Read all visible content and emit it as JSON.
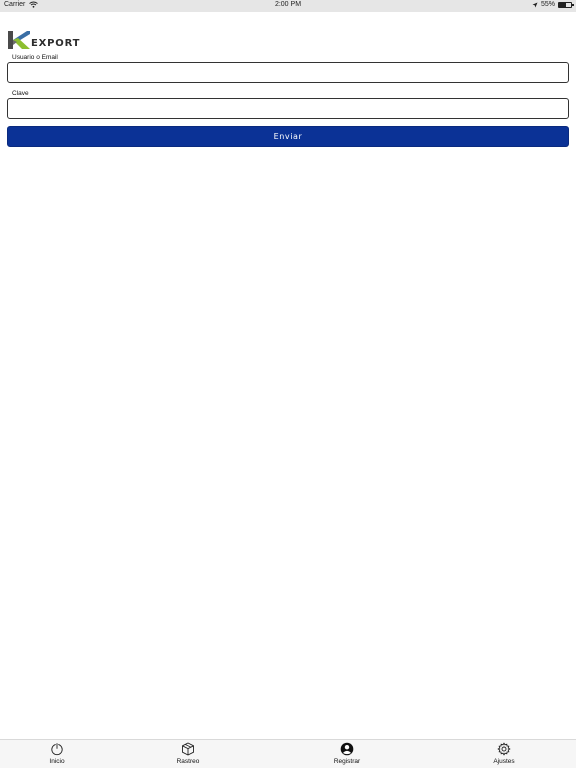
{
  "status_bar": {
    "carrier": "Carrier",
    "time": "2:00 PM",
    "battery": "55%",
    "battery_level": 0.55
  },
  "logo": {
    "text": "EXPORT",
    "icon": "k-logo-icon"
  },
  "form": {
    "username": {
      "label": "Usuario o Email",
      "value": "",
      "placeholder": ""
    },
    "password": {
      "label": "Clave",
      "value": "",
      "placeholder": ""
    },
    "submit_label": "Enviar"
  },
  "colors": {
    "primary_button": "#0b3296",
    "logo_green": "#8dbf2f",
    "logo_gray": "#4a4a4a"
  },
  "tab_bar": {
    "items": [
      {
        "label": "Inicio",
        "icon": "power-icon"
      },
      {
        "label": "Rastreo",
        "icon": "package-icon"
      },
      {
        "label": "Registrar",
        "icon": "user-circle-icon"
      },
      {
        "label": "Ajustes",
        "icon": "gear-icon"
      }
    ]
  }
}
